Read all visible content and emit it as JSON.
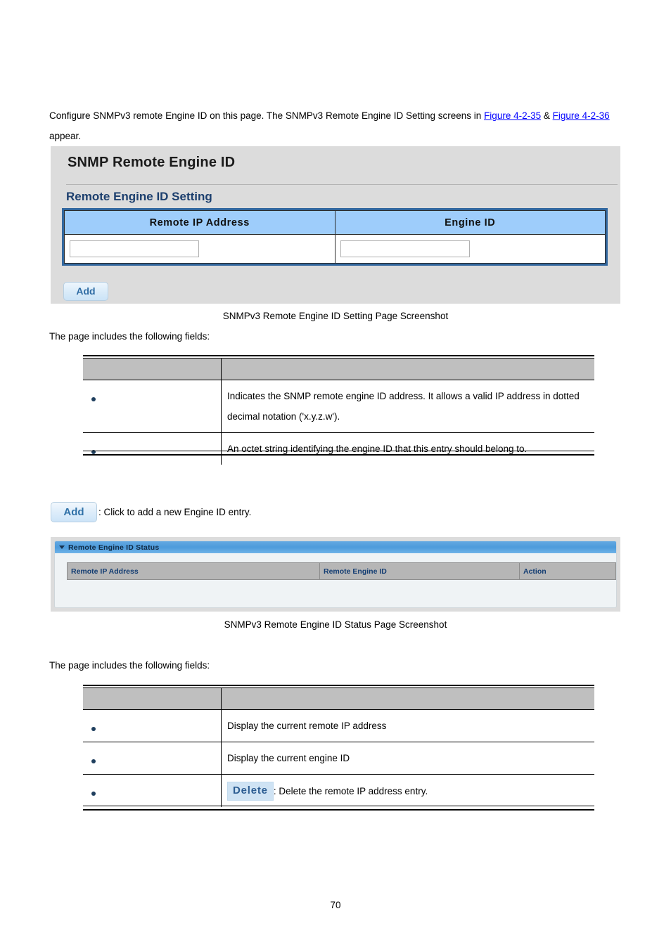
{
  "intro": {
    "part1": "Configure SNMPv3 remote Engine ID on this page. The SNMPv3 Remote Engine ID Setting screens in ",
    "link1": "Figure 4-2-35",
    "amp": " & ",
    "link2": "Figure 4-2-36",
    "part2": " appear."
  },
  "screenshot_setting": {
    "title": "SNMP Remote Engine ID",
    "section_title": "Remote Engine ID Setting",
    "table": {
      "headers": [
        "Remote IP Address",
        "Engine ID"
      ],
      "inputs": {
        "remote_ip_value": "",
        "remote_ip_placeholder": "",
        "engine_id_value": "",
        "engine_id_placeholder": ""
      }
    },
    "add_button": "Add"
  },
  "caption_setting": "SNMPv3 Remote Engine ID Setting Page Screenshot",
  "page_includes_1": "The page includes the following fields:",
  "fields_table_1": {
    "headers": [
      "",
      ""
    ],
    "rows": [
      {
        "object": "",
        "description": "Indicates the SNMP remote engine ID address. It allows a valid IP address in dotted decimal notation ('x.y.z.w')."
      },
      {
        "object": "",
        "description": "An octet string identifying the engine ID that this entry should belong to."
      }
    ]
  },
  "buttons_note": {
    "add_button": "Add",
    "add_description": ": Click to add a new Engine ID entry."
  },
  "screenshot_status": {
    "panel_title": "Remote Engine ID Status",
    "table": {
      "headers": [
        "Remote IP Address",
        "Remote Engine ID",
        "Action"
      ],
      "rows": []
    }
  },
  "caption_status": "SNMPv3 Remote Engine ID Status Page Screenshot",
  "page_includes_2": "The page includes the following fields:",
  "fields_table_2": {
    "headers": [
      "",
      ""
    ],
    "rows": [
      {
        "object": "",
        "description": "Display the current remote IP address"
      },
      {
        "object": "",
        "description": "Display the current engine ID"
      },
      {
        "object": "",
        "delete_button": "Delete",
        "description": ": Delete the remote IP address entry."
      }
    ]
  },
  "page_number": "70",
  "colors": {
    "link": "#0000ff",
    "panel_bg": "#dcdcdc",
    "table_header_blue": "#9ecdfb",
    "table_border_blue": "#32679e",
    "status_bar_blue": "#4d9bdb",
    "status_body": "#eff3f5",
    "field_header_gray": "#bfbfbf",
    "status_header_gray": "#b6b6b6",
    "status_header_text": "#123c72",
    "button_text_blue": "#2f6ca4",
    "delete_button_bg": "#cfe3f4"
  }
}
